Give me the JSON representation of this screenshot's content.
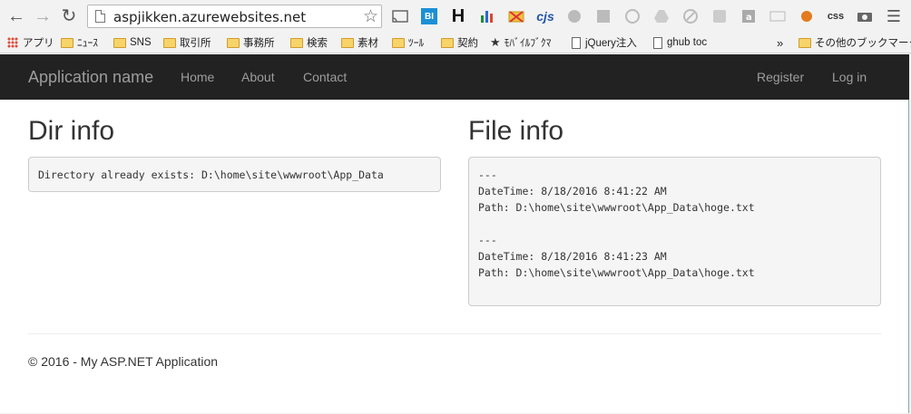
{
  "browser": {
    "url": "aspjikken.azurewebsites.net",
    "bookmarks": [
      "アプリ",
      "ﾆｭｰｽ",
      "SNS",
      "取引所",
      "事務所",
      "検索",
      "素材",
      "ﾂｰﾙ",
      "契約",
      "ﾓﾊﾞｲﾙﾌﾞｸﾏ",
      "jQuery注入",
      "ghub toc",
      "その他のブックマーク"
    ],
    "extensions": [
      "BI",
      "H",
      "cjs",
      "css"
    ],
    "overflow_chevron": "»"
  },
  "site": {
    "brand": "Application name",
    "nav": [
      "Home",
      "About",
      "Contact"
    ],
    "auth": [
      "Register",
      "Log in"
    ]
  },
  "dir": {
    "heading": "Dir info",
    "text": "Directory already exists: D:\\home\\site\\wwwroot\\App_Data"
  },
  "file": {
    "heading": "File info",
    "text": "---\nDateTime: 8/18/2016 8:41:22 AM\nPath: D:\\home\\site\\wwwroot\\App_Data\\hoge.txt\n\n---\nDateTime: 8/18/2016 8:41:23 AM\nPath: D:\\home\\site\\wwwroot\\App_Data\\hoge.txt\n"
  },
  "footer": "© 2016 - My ASP.NET Application"
}
